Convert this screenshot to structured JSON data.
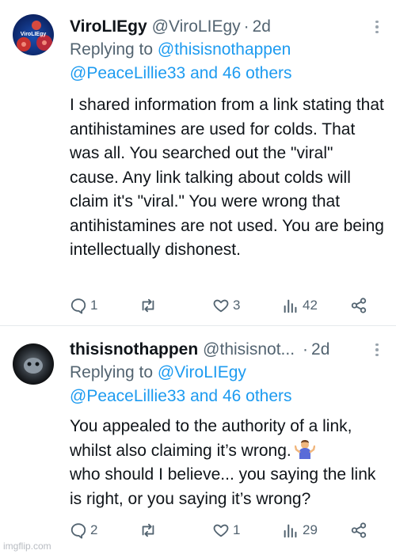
{
  "tweets": [
    {
      "name": "ViroLIEgy",
      "handle": "@ViroLIEgy",
      "sep": "·",
      "time": "2d",
      "replying_prefix": "Replying to",
      "replying_user": "@thisisnothappen",
      "replying_others": "@PeaceLillie33 and 46 others",
      "text": "I shared information from a link stating that antihistamines are used for colds. That was all. You searched out the \"viral\" cause. Any link talking about colds will claim it's \"viral.\" You were wrong that antihistamines are not used. You are being intellectually dishonest.",
      "avatar_text": "ViroLIEgy",
      "stats": {
        "replies": "1",
        "retweets": "",
        "likes": "3",
        "views": "42"
      }
    },
    {
      "name": "thisisnothappen",
      "handle": "@thisisnot...",
      "sep": "·",
      "time": "2d",
      "replying_prefix": "Replying to",
      "replying_user": "@ViroLIEgy",
      "replying_others": "@PeaceLillie33 and 46 others",
      "text": "You appealed to the authority of a link, whilst also claiming it’s wrong.",
      "text_after": "who should I believe... you saying the link is right, or you saying it’s wrong?",
      "emoji": "person-shrugging",
      "stats": {
        "replies": "2",
        "retweets": "",
        "likes": "1",
        "views": "29"
      }
    }
  ],
  "watermark": "imgflip.com",
  "colors": {
    "text": "#0f1419",
    "secondary": "#536471",
    "link": "#1d9bf0",
    "divider": "#e6e9ec"
  }
}
